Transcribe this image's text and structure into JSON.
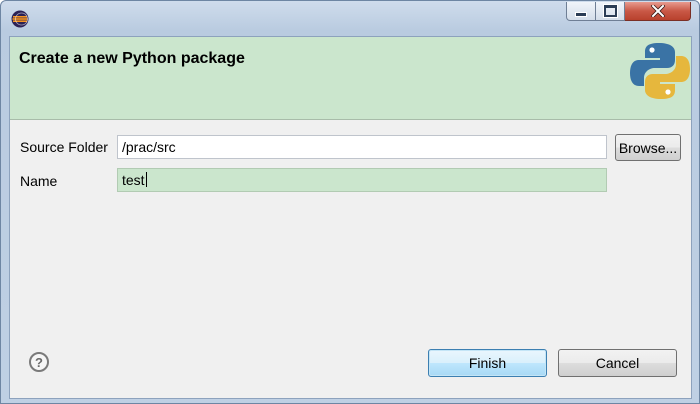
{
  "window": {
    "controls": {
      "minimize_icon": "minimize-icon",
      "maximize_icon": "maximize-icon",
      "close_icon": "close-icon"
    },
    "app_icon": "eclipse-icon"
  },
  "banner": {
    "title": "Create a new Python package",
    "logo_icon": "python-logo-icon",
    "background": "#cbe6cd"
  },
  "form": {
    "source_folder": {
      "label": "Source Folder",
      "value": "/prac/src",
      "browse_label": "Browse..."
    },
    "name": {
      "label": "Name",
      "value": "test"
    }
  },
  "footer": {
    "help_icon": "help-icon",
    "help_glyph": "?",
    "finish_label": "Finish",
    "cancel_label": "Cancel"
  }
}
